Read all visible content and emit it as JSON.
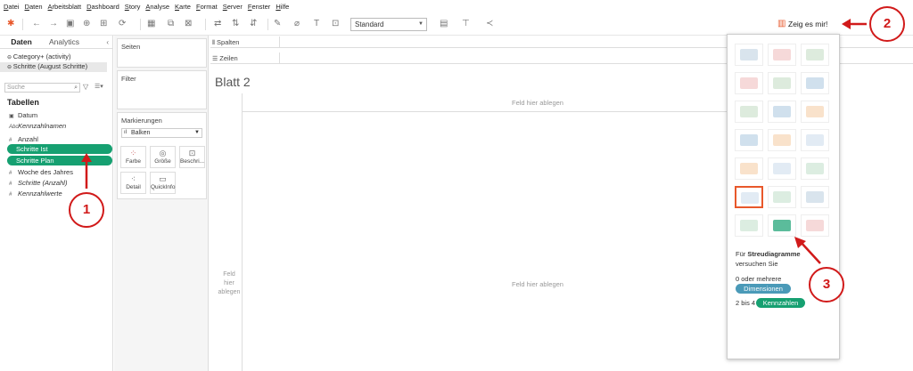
{
  "menu": [
    "Datei",
    "Daten",
    "Arbeitsblatt",
    "Dashboard",
    "Story",
    "Analyse",
    "Karte",
    "Format",
    "Server",
    "Fenster",
    "Hilfe"
  ],
  "toolbar": {
    "fit_select": "Standard",
    "show_me_label": "Zeig es mir!"
  },
  "left": {
    "tab_data": "Daten",
    "tab_analytics": "Analytics",
    "sources": [
      "Category+ (activity)",
      "Schritte (August Schritte)"
    ],
    "search_placeholder": "Suche",
    "tables_heading": "Tabellen",
    "fields": [
      {
        "label": "Datum",
        "icon": "calendar"
      },
      {
        "label": "Kennzahlnamen",
        "icon": "abc"
      },
      {
        "label": "Anzahl",
        "icon": "hash"
      },
      {
        "label": "Schritte Ist",
        "icon": "hash"
      },
      {
        "label": "Schritte Plan",
        "icon": "hash"
      },
      {
        "label": "Woche des Jahres",
        "icon": "hash"
      },
      {
        "label": "Schritte (Anzahl)",
        "icon": "hash"
      },
      {
        "label": "Kennzahlwerte",
        "icon": "hash"
      }
    ]
  },
  "cards": {
    "pages": "Seiten",
    "filters": "Filter",
    "marks": "Markierungen",
    "mark_type": "Balken",
    "mark_buttons": [
      "Farbe",
      "Größe",
      "Beschri...",
      "Detail",
      "QuickInfo"
    ]
  },
  "shelves": {
    "columns": "Spalten",
    "rows": "Zeilen"
  },
  "sheet": {
    "title": "Blatt 2",
    "drop_top": "Feld hier ablegen",
    "drop_left": [
      "Feld",
      "hier",
      "ablegen"
    ],
    "drop_center": "Feld hier ablegen"
  },
  "showme": {
    "hint_prefix": "Für ",
    "hint_bold": "Streudiagramme",
    "hint_suffix": "versuchen Sie",
    "dims_prefix": "0 oder mehrere",
    "dims_badge": "Dimensionen",
    "meas_prefix": "2 bis 4",
    "meas_badge": "Kennzahlen"
  },
  "annotations": [
    "1",
    "2",
    "3"
  ],
  "colors": {
    "green_pill": "#16a071",
    "dim_badge": "#4a9ab8",
    "red": "#d11a1a",
    "selected_border": "#e8582b"
  }
}
